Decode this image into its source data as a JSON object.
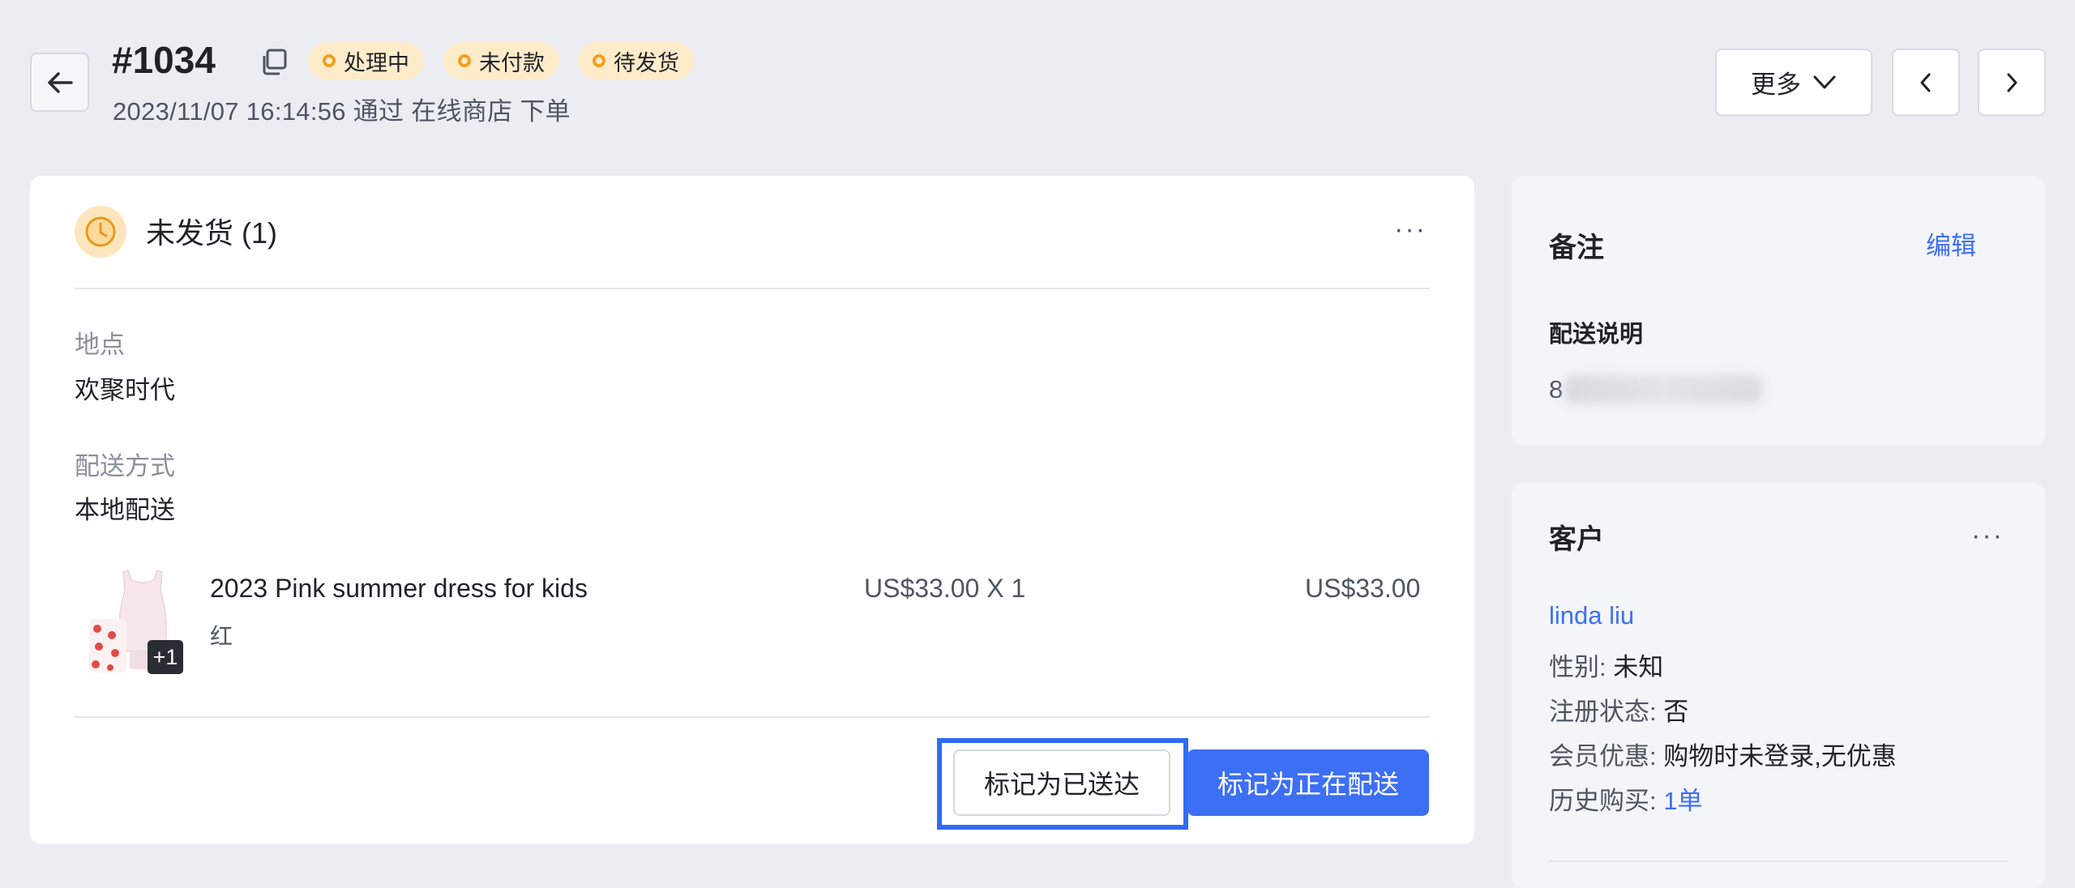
{
  "header": {
    "order_id": "#1034",
    "badges": [
      {
        "label": "处理中"
      },
      {
        "label": "未付款"
      },
      {
        "label": "待发货"
      }
    ],
    "subline": "2023/11/07 16:14:56 通过 在线商店 下单",
    "more_label": "更多"
  },
  "main": {
    "section_title": "未发货 (1)",
    "location_label": "地点",
    "location_value": "欢聚时代",
    "shipping_label": "配送方式",
    "shipping_value": "本地配送",
    "product": {
      "name": "2023 Pink summer dress for kids",
      "variant": "红",
      "unit_price": "US$33.00 X 1",
      "total": "US$33.00",
      "extra_images": "+1"
    },
    "buttons": {
      "mark_delivered": "标记为已送达",
      "mark_delivering": "标记为正在配送"
    }
  },
  "note": {
    "title": "备注",
    "edit_label": "编辑",
    "delivery_title": "配送说明",
    "delivery_value_prefix": "8"
  },
  "customer": {
    "title": "客户",
    "name": "linda liu",
    "gender_label": "性别:",
    "gender_value": "未知",
    "registered_label": "注册状态:",
    "registered_value": "否",
    "discount_label": "会员优惠:",
    "discount_value": "购物时未登录,无优惠",
    "history_label": "历史购买:",
    "history_value": "1单"
  },
  "colors": {
    "accent": "#3d6ff4",
    "badge_bg": "#fdebc9",
    "badge_dot": "#f0a020",
    "highlight": "#2f6bf6",
    "background": "#ebedf2"
  }
}
